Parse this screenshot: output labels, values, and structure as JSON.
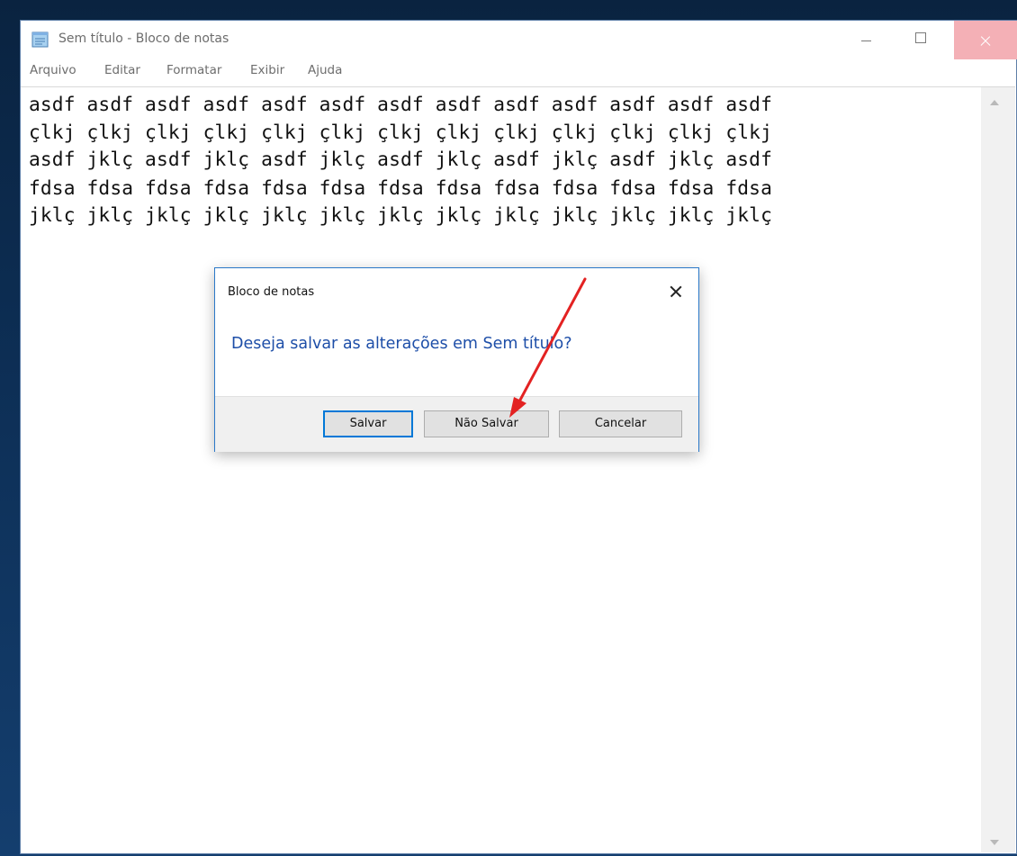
{
  "window": {
    "title": "Sem título - Bloco de notas"
  },
  "menu": {
    "items": [
      {
        "label": "Arquivo"
      },
      {
        "label": "Editar"
      },
      {
        "label": "Formatar"
      },
      {
        "label": "Exibir"
      },
      {
        "label": "Ajuda"
      }
    ]
  },
  "editor": {
    "lines": [
      "asdf asdf asdf asdf asdf asdf asdf asdf asdf asdf asdf asdf asdf",
      "çlkj çlkj çlkj çlkj çlkj çlkj çlkj çlkj çlkj çlkj çlkj çlkj çlkj",
      "asdf jklç asdf jklç asdf jklç asdf jklç asdf jklç asdf jklç asdf",
      "fdsa fdsa fdsa fdsa fdsa fdsa fdsa fdsa fdsa fdsa fdsa fdsa fdsa",
      "jklç jklç jklç jklç jklç jklç jklç jklç jklç jklç jklç jklç jklç"
    ]
  },
  "dialog": {
    "title": "Bloco de notas",
    "message": "Deseja salvar as alterações em Sem título?",
    "buttons": {
      "save": "Salvar",
      "dont_save": "Não Salvar",
      "cancel": "Cancelar"
    }
  },
  "colors": {
    "dialog_message": "#1d4ea8",
    "dialog_border": "#2a78c8",
    "default_button_border": "#0078d7",
    "annotation_arrow": "#e32222"
  },
  "icons": {
    "app": "notepad-icon",
    "minimize": "minimize-icon",
    "maximize": "maximize-icon",
    "close": "close-icon"
  }
}
